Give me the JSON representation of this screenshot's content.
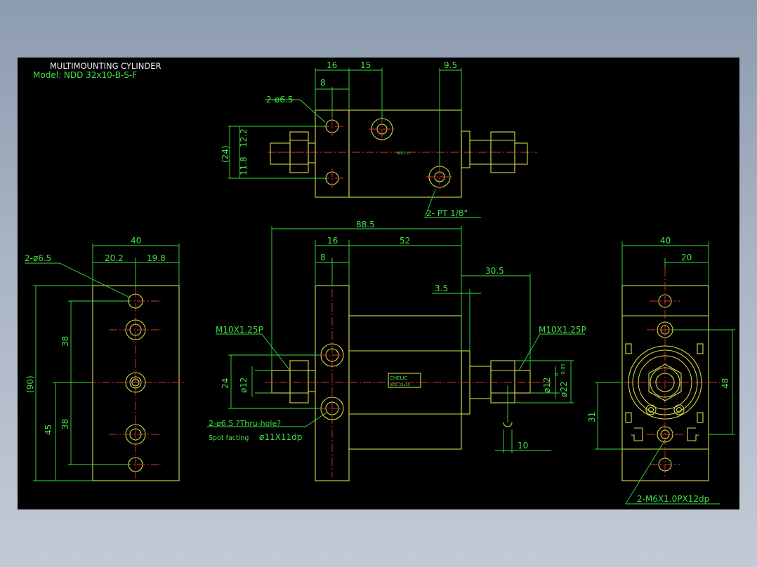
{
  "title": "MULTIMOUNTING CYLINDER",
  "model": "Model: NDD 32x10-B-S-F",
  "colors": {
    "background": "#000000",
    "outline": "#d8d84a",
    "dimension": "#35e03a",
    "centerline": "#e03030",
    "window_gradient_top": "#8d9bb0"
  },
  "top_view": {
    "dims": {
      "d16": "16",
      "d15": "15",
      "d8": "8",
      "d9_5": "9.5",
      "d12_2": "12.2",
      "d11_8": "11.8",
      "d24": "(24)"
    },
    "holes_label": "2-ø6.5",
    "port_label": "2- PT 1/8\"",
    "body_text": "NDD 32"
  },
  "front_view": {
    "dims": {
      "d88_5": "88.5",
      "d16": "16",
      "d52": "52",
      "d8": "8",
      "d30_5": "30.5",
      "d3_5": "3.5",
      "d24": "24",
      "d12_left": "ø12",
      "d12_right": "ø12",
      "d22": "ø22",
      "d22_tol": "-0.05",
      "d22_tol0": "0",
      "d10": "10"
    },
    "thread_left": "M10X1.25P",
    "thread_right": "M10X1.25P",
    "holes_label": "2-ø6.5 ?Thru-hole?",
    "spot_label": "Spot facting",
    "spot_value": "ø11X11dp",
    "nameplate_line1": "CHELIC",
    "nameplate_line2": "NDD 32x10"
  },
  "left_view": {
    "dims": {
      "d40": "40",
      "d20_2": "20.2",
      "d19_8": "19.8",
      "d90": "(90)",
      "d38_top": "38",
      "d38_bot": "38",
      "d45": "45"
    },
    "holes_label": "2-ø6.5"
  },
  "right_view": {
    "dims": {
      "d40": "40",
      "d20": "20",
      "d48": "48",
      "d31": "31"
    },
    "tap_label": "2-M6X1.0PX12dp"
  }
}
